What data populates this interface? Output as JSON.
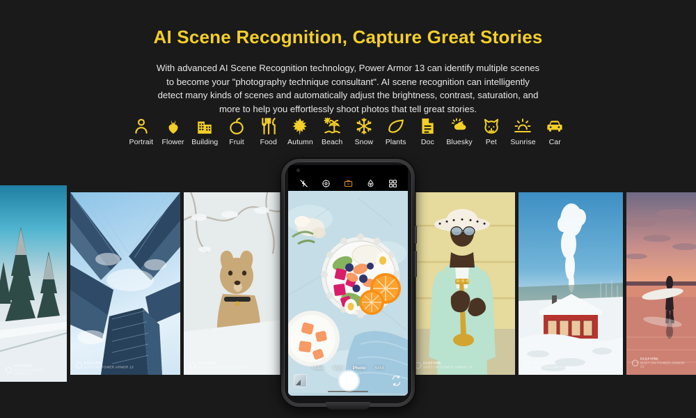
{
  "headline": "AI Scene Recognition, Capture Great Stories",
  "body_copy": "With advanced AI Scene Recognition technology, Power Armor 13 can identify multiple scenes to become your \"photography technique consultant\". AI scene recognition can intelligently detect many kinds of scenes and automatically adjust the brightness, contrast, saturation, and more to help you effortlessly shoot photos that tell great stories.",
  "colors": {
    "background": "#1a1a1a",
    "accent_yellow": "#f4cf28",
    "body_text": "#e8e8e8",
    "camera_active": "#e08a22"
  },
  "scenes": [
    {
      "icon": "portrait-icon",
      "label": "Portrait"
    },
    {
      "icon": "flower-icon",
      "label": "Flower"
    },
    {
      "icon": "building-icon",
      "label": "Building"
    },
    {
      "icon": "fruit-icon",
      "label": "Fruit"
    },
    {
      "icon": "food-icon",
      "label": "Food"
    },
    {
      "icon": "autumn-icon",
      "label": "Autumn"
    },
    {
      "icon": "beach-icon",
      "label": "Beach"
    },
    {
      "icon": "snow-icon",
      "label": "Snow"
    },
    {
      "icon": "plants-icon",
      "label": "Plants"
    },
    {
      "icon": "doc-icon",
      "label": "Doc"
    },
    {
      "icon": "bluesky-icon",
      "label": "Bluesky"
    },
    {
      "icon": "pet-icon",
      "label": "Pet"
    },
    {
      "icon": "sunrise-icon",
      "label": "Sunrise"
    },
    {
      "icon": "car-icon",
      "label": "Car"
    }
  ],
  "watermark": {
    "brand": "ULEFONE",
    "shot_on": "SHOT ON POWER ARMOR 13"
  },
  "gallery": [
    {
      "name": "snowy-pine-forest",
      "scene": "Snow"
    },
    {
      "name": "skyscrapers-looking-up",
      "scene": "Building"
    },
    {
      "name": "labrador-dog-in-snow",
      "scene": "Pet"
    },
    {
      "name": "trumpet-player-portrait",
      "scene": "Portrait"
    },
    {
      "name": "red-cabin-winter",
      "scene": "Snow"
    },
    {
      "name": "surfer-sunset-beach",
      "scene": "Sunrise"
    }
  ],
  "phone": {
    "model": "Power Armor 13",
    "camera": {
      "top_icons": [
        {
          "icon": "flash-off-icon",
          "active": false
        },
        {
          "icon": "hdr-settings-icon",
          "active": false
        },
        {
          "icon": "ai-camera-icon",
          "active": true
        },
        {
          "icon": "filter-droplet-icon",
          "active": false
        },
        {
          "icon": "grid-modes-icon",
          "active": false
        }
      ],
      "modes": [
        "Video",
        "Night",
        "Photo",
        "64M"
      ],
      "active_mode": "Photo",
      "thumbnail": "last-photo-thumbnail",
      "shutter": "shutter-button",
      "flip": "flip-camera-icon",
      "viewfinder_subject": "fruit-salad-flatlay"
    }
  }
}
